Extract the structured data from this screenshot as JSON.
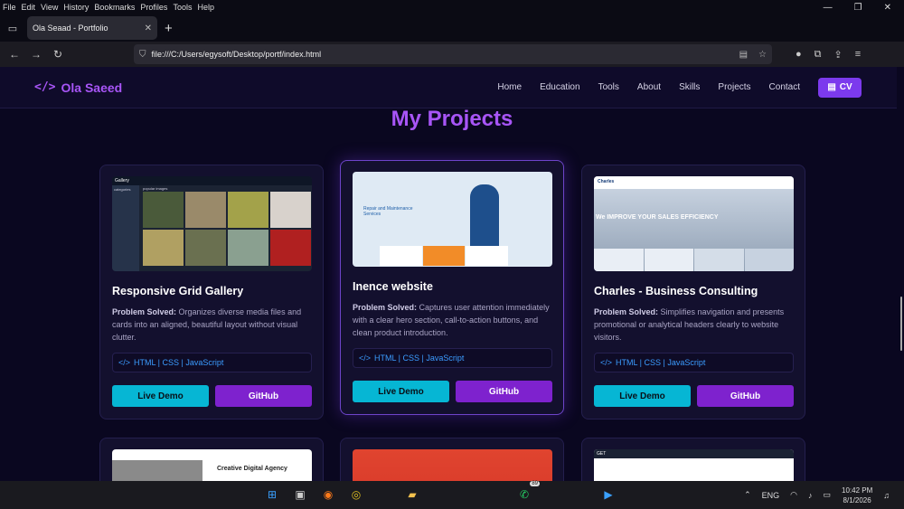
{
  "browser": {
    "menu": [
      "File",
      "Edit",
      "View",
      "History",
      "Bookmarks",
      "Profiles",
      "Tools",
      "Help"
    ],
    "tab_title": "Ola Seaad - Portfolio",
    "url": "file:///C:/Users/egysoft/Desktop/portf/index.html"
  },
  "site": {
    "logo_text": "Ola Saeed",
    "nav": [
      "Home",
      "Education",
      "Tools",
      "About",
      "Skills",
      "Projects",
      "Contact"
    ],
    "cv_label": "CV",
    "section_title": "My Projects"
  },
  "projects": [
    {
      "title": "Responsive Grid Gallery",
      "problem_label": "Problem Solved:",
      "problem_text": " Organizes diverse media files and cards into an aligned, beautiful layout without visual clutter.",
      "tech": "HTML | CSS | JavaScript",
      "demo_label": "Live Demo",
      "github_label": "GitHub",
      "thumb": {
        "brand": "Gallery",
        "heading": "popular images",
        "side_title": "categories"
      }
    },
    {
      "title": "Inence website",
      "problem_label": "Problem Solved:",
      "problem_text": " Captures user attention immediately with a clear hero section, call-to-action buttons, and clean product introduction.",
      "tech": "HTML | CSS | JavaScript",
      "demo_label": "Live Demo",
      "github_label": "GitHub",
      "thumb": {
        "hero": "Repair and Maintenance Services"
      }
    },
    {
      "title": "Charles - Business Consulting",
      "problem_label": "Problem Solved:",
      "problem_text": " Simplifies navigation and presents promotional or analytical headers clearly to website visitors.",
      "tech": "HTML | CSS | JavaScript",
      "demo_label": "Live Demo",
      "github_label": "GitHub",
      "thumb": {
        "brand": "Charles",
        "headline": "We IMPROVE YOUR SALES EFFICIENCY"
      }
    }
  ],
  "next_row": {
    "first_thumb_heading": "Creative Digital Agency",
    "third_thumb_brand": "GET"
  },
  "taskbar": {
    "lang": "ENG",
    "time": "10:42 PM",
    "date": "8/1/2026",
    "whatsapp_badge": "89"
  }
}
